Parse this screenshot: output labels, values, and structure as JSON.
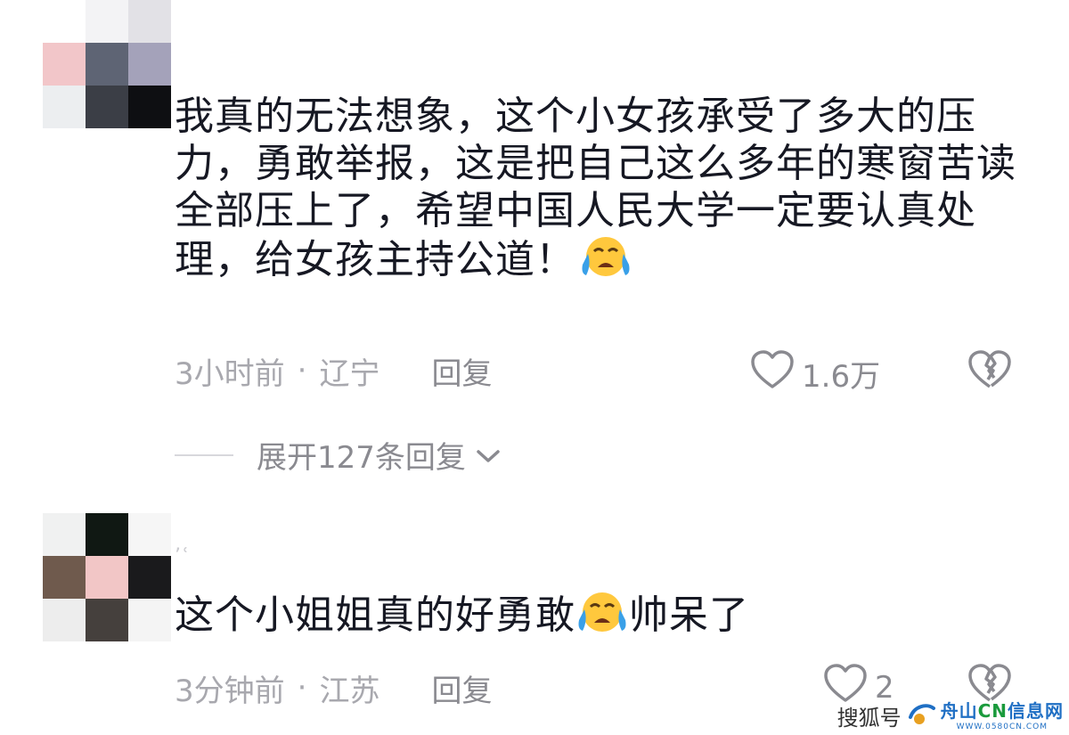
{
  "comments": [
    {
      "user_name": "",
      "text": "我真的无法想象，这个小女孩承受了多大的压力，勇敢举报，这是把自己这么多年的寒窗苦读全部压上了，希望中国人民大学一定要认真处理，给女孩主持公道！",
      "emoji": "loudly-crying-face",
      "time": "3小时前",
      "location": "辽宁",
      "separator": "·",
      "reply_label": "回复",
      "likes": "1.6万",
      "expand_label": "展开127条回复"
    },
    {
      "user_name": "’ ʿ",
      "text_before": "这个小姐姐真的好勇敢",
      "text_after": "帅呆了",
      "emoji": "loudly-crying-face",
      "time": "3分钟前",
      "location": "江苏",
      "separator": "·",
      "reply_label": "回复",
      "likes": "2"
    }
  ],
  "watermark": {
    "sohu": "搜狐号",
    "site_name_part1": "舟山",
    "site_name_cn": "CN",
    "site_name_part2": "信息网",
    "site_url": "WWW.0580CN.COM"
  },
  "colors": {
    "text": "#161823",
    "meta": "#a8a8ae",
    "icon": "#8a8a90",
    "emoji_face": "#ffc83d",
    "emoji_tears": "#3aa0e8"
  }
}
